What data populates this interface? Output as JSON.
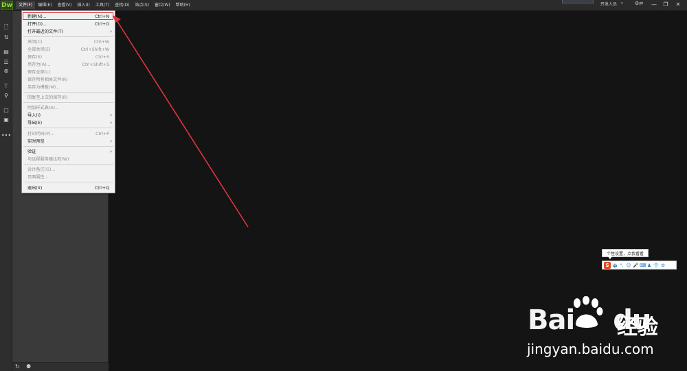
{
  "app": {
    "logo_text": "Dw"
  },
  "menubar": {
    "items": [
      "文件(F)",
      "编辑(E)",
      "查看(V)",
      "插入(I)",
      "工具(T)",
      "查找(D)",
      "站点(S)",
      "窗口(W)",
      "帮助(H)"
    ],
    "workspace_label": "开发人员",
    "window_buttons": [
      "—",
      "❐",
      "✕"
    ]
  },
  "file_menu": {
    "items": [
      {
        "label": "新建(N)...",
        "shortcut": "Ctrl+N",
        "enabled": true,
        "highlighted": true
      },
      {
        "label": "打开(O)...",
        "shortcut": "Ctrl+O",
        "enabled": true
      },
      {
        "label": "打开最近的文件(T)",
        "shortcut": "",
        "enabled": true,
        "submenu": true
      },
      {
        "label": "关闭(C)",
        "shortcut": "Ctrl+W",
        "enabled": false
      },
      {
        "label": "全部关闭(E)",
        "shortcut": "Ctrl+Shift+W",
        "enabled": false
      },
      {
        "label": "保存(S)",
        "shortcut": "Ctrl+S",
        "enabled": false
      },
      {
        "label": "另存为(A)...",
        "shortcut": "Ctrl+Shift+S",
        "enabled": false
      },
      {
        "label": "保存全部(L)",
        "shortcut": "",
        "enabled": false
      },
      {
        "label": "保存所有相关文件(R)",
        "shortcut": "",
        "enabled": false
      },
      {
        "label": "另存为模板(M)...",
        "shortcut": "",
        "enabled": false
      },
      {
        "label": "回复至上次的保存(R)",
        "shortcut": "",
        "enabled": false
      },
      {
        "label": "附加样式表(A)...",
        "shortcut": "",
        "enabled": false
      },
      {
        "label": "导入(I)",
        "shortcut": "",
        "enabled": true,
        "submenu": true
      },
      {
        "label": "导出(E)",
        "shortcut": "",
        "enabled": true,
        "submenu": true
      },
      {
        "label": "打印代码(P)...",
        "shortcut": "Ctrl+P",
        "enabled": false
      },
      {
        "label": "实时预览",
        "shortcut": "",
        "enabled": true,
        "submenu": true
      },
      {
        "label": "验证",
        "shortcut": "",
        "enabled": true,
        "submenu": true
      },
      {
        "label": "与远程服务器比较(W)",
        "shortcut": "",
        "enabled": false
      },
      {
        "label": "设计备注(G)...",
        "shortcut": "",
        "enabled": false
      },
      {
        "label": "页面属性...",
        "shortcut": "",
        "enabled": false
      },
      {
        "label": "退出(X)",
        "shortcut": "Ctrl+Q",
        "enabled": true
      }
    ]
  },
  "ime": {
    "tooltip": "个性设置，点我看看",
    "logo": "S",
    "mode": "中",
    "icons": [
      "°,",
      "☺",
      "🎤",
      "⌨",
      "♟",
      "👕",
      "⚙"
    ]
  },
  "watermark": {
    "brand": "Bai",
    "brand_suffix": "du",
    "cn": "经验",
    "url": "jingyan.baidu.com"
  },
  "colors": {
    "highlight": "#e0343d",
    "arrow": "#e0343d",
    "editor_bg": "#141414",
    "logo_green": "#8fdc3a"
  }
}
